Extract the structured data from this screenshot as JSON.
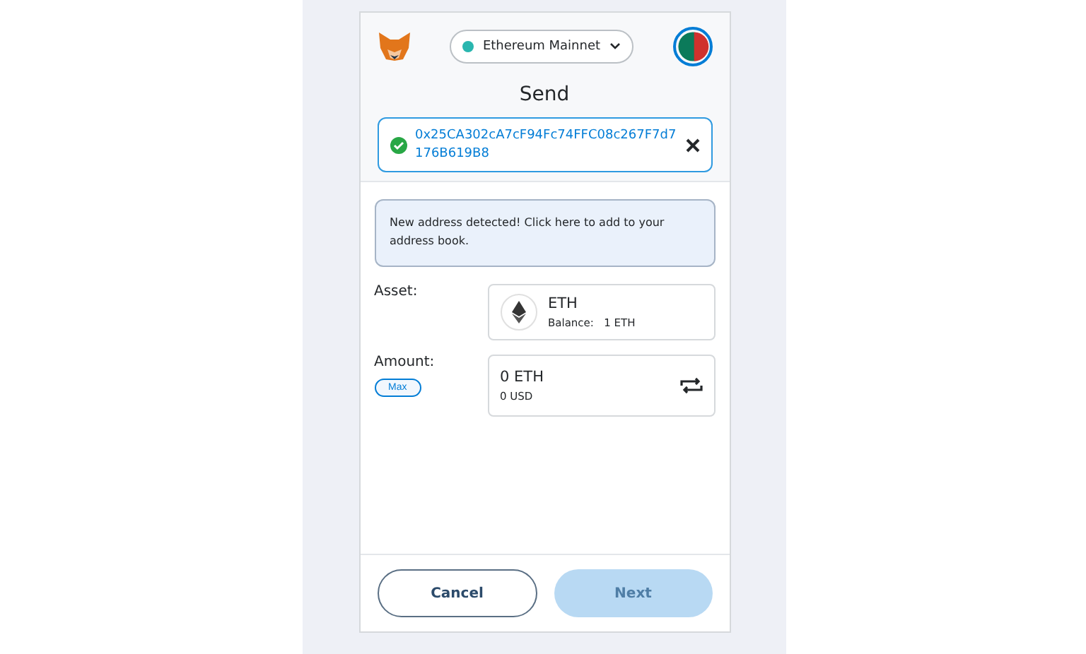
{
  "network": {
    "name": "Ethereum Mainnet",
    "color": "#29b6af"
  },
  "title": "Send",
  "recipient": {
    "address": "0x25CA302cA7cF94Fc74FFC08c267F7d7 176B619B8",
    "valid": true
  },
  "notice": "New address detected! Click here to add to your address book.",
  "asset": {
    "label": "Asset:",
    "symbol": "ETH",
    "balance_label": "Balance:",
    "balance": "1 ETH"
  },
  "amount": {
    "label": "Amount:",
    "max": "Max",
    "value": "0 ETH",
    "fiat": "0 USD"
  },
  "buttons": [
    {
      "label": "Cancel",
      "kind": "secondary",
      "disabled": false
    },
    {
      "label": "Next",
      "kind": "primary",
      "disabled": true
    }
  ]
}
